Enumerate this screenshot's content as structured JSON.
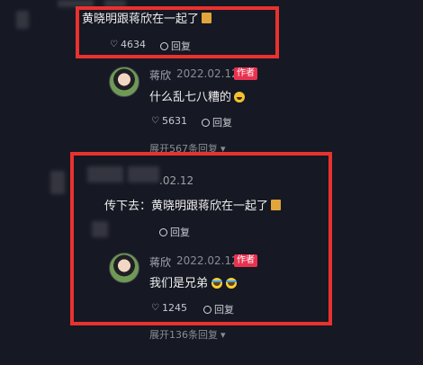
{
  "colors": {
    "background": "#161823",
    "highlight": "#e8322f",
    "author_badge": "#e8324f"
  },
  "thread1": {
    "comment_text": "黄晓明跟蒋欣在一起了",
    "likes": "4634",
    "reply_label": "回复",
    "reply": {
      "username": "蒋欣",
      "date": "2022.02.12",
      "author_tag": "作者",
      "text": "什么乱七八糟的",
      "likes": "5631",
      "reply_label": "回复"
    },
    "expand": "展开567条回复"
  },
  "thread2": {
    "date_partial": ".02.12",
    "comment_text": "传下去：黄晓明跟蒋欣在一起了",
    "reply_label": "回复",
    "reply": {
      "username": "蒋欣",
      "date": "2022.02.12",
      "author_tag": "作者",
      "text": "我们是兄弟",
      "likes": "1245",
      "reply_label": "回复"
    },
    "expand": "展开136条回复"
  }
}
